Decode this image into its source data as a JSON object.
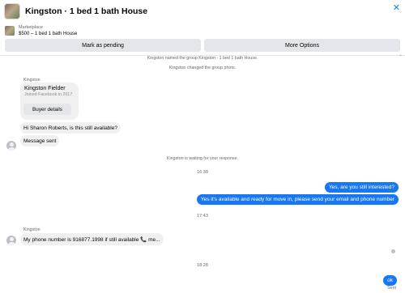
{
  "header": {
    "title": "Kingston · 1 bed 1 bath House",
    "close_icon": "close-icon"
  },
  "listing": {
    "source": "Marketplace",
    "price_line": "$500 – 1 bed 1 bath House"
  },
  "actions": {
    "mark_pending": "Mark as pending",
    "more_options": "More Options"
  },
  "thread": {
    "system_named": "Kingston named the group Kingston · 1 bed 1 bath House.",
    "system_photo": "Kingston changed the group photo.",
    "sender_1": "Kingston",
    "profile_card": {
      "name": "Kingston Fielder",
      "joined": "Joined Facebook in 2017",
      "button": "Buyer details"
    },
    "msg_available": "Hi Sharon Roberts, is this still available?",
    "msg_sent": "Message sent",
    "system_waiting": "Kingston is waiting for your response.",
    "time_1": "16:39",
    "out_interested": "Yes, are you still interested?",
    "out_available": "Yes it's available and ready for move in, please send your email and phone number",
    "time_2": "17:43",
    "sender_2": "Kingston",
    "msg_phone": "My phone number is 916877.1998 if still available 📞 me...",
    "time_3": "18:28",
    "out_ok": "ok",
    "sent_status": "Sent"
  },
  "colors": {
    "accent": "#1877f2",
    "bubble_in": "#f0f0f0",
    "button_gray": "#e4e6eb",
    "meta_text": "#65676b"
  }
}
